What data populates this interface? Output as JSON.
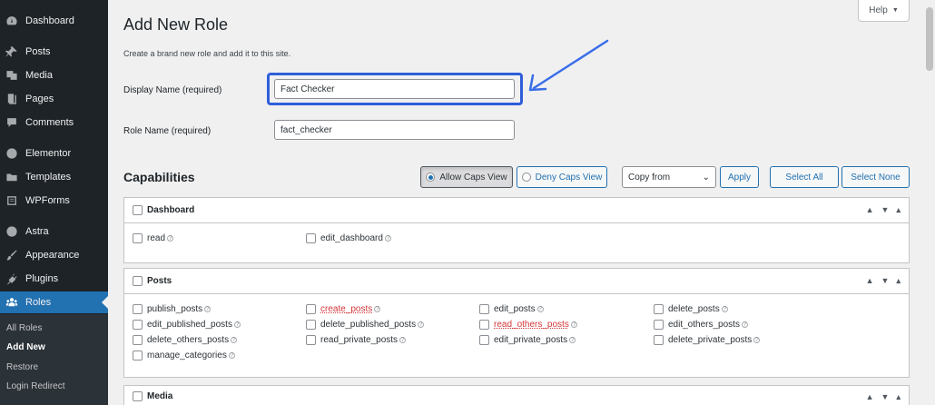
{
  "sidebar": {
    "items": [
      {
        "label": "Dashboard",
        "icon": "dashboard-icon"
      },
      {
        "label": "Posts",
        "icon": "pin-icon"
      },
      {
        "label": "Media",
        "icon": "media-icon"
      },
      {
        "label": "Pages",
        "icon": "pages-icon"
      },
      {
        "label": "Comments",
        "icon": "comments-icon"
      },
      {
        "label": "Elementor",
        "icon": "elementor-icon"
      },
      {
        "label": "Templates",
        "icon": "folder-icon"
      },
      {
        "label": "WPForms",
        "icon": "forms-icon"
      },
      {
        "label": "Astra",
        "icon": "astra-icon"
      },
      {
        "label": "Appearance",
        "icon": "brush-icon"
      },
      {
        "label": "Plugins",
        "icon": "plugin-icon"
      },
      {
        "label": "Roles",
        "icon": "users-icon"
      }
    ],
    "submenu": [
      "All Roles",
      "Add New",
      "Restore",
      "Login Redirect"
    ],
    "active_color": "#2271b1"
  },
  "header": {
    "title": "Add New Role",
    "help": "Help",
    "description": "Create a brand new role and add it to this site."
  },
  "form": {
    "display_name_label": "Display Name (required)",
    "display_name_value": "Fact Checker",
    "role_name_label": "Role Name (required)",
    "role_name_value": "fact_checker",
    "highlight_color": "#2f5ed9"
  },
  "capabilities": {
    "title": "Capabilities",
    "allow_view": "Allow Caps View",
    "deny_view": "Deny Caps View",
    "copy_from": "Copy from",
    "apply": "Apply",
    "select_all": "Select All",
    "select_none": "Select None"
  },
  "panels": {
    "dashboard": {
      "title": "Dashboard",
      "caps": [
        "read",
        "edit_dashboard"
      ]
    },
    "posts": {
      "title": "Posts",
      "caps": [
        "publish_posts",
        "create_posts",
        "edit_posts",
        "delete_posts",
        "edit_published_posts",
        "delete_published_posts",
        "read_others_posts",
        "edit_others_posts",
        "delete_others_posts",
        "read_private_posts",
        "edit_private_posts",
        "delete_private_posts",
        "manage_categories"
      ],
      "red_caps": [
        "create_posts",
        "read_others_posts"
      ]
    },
    "media": {
      "title": "Media"
    }
  },
  "help_glyph": "?",
  "ctrl_glyphs": {
    "up": "⌃",
    "down": "⌄",
    "toggle": "▲"
  }
}
